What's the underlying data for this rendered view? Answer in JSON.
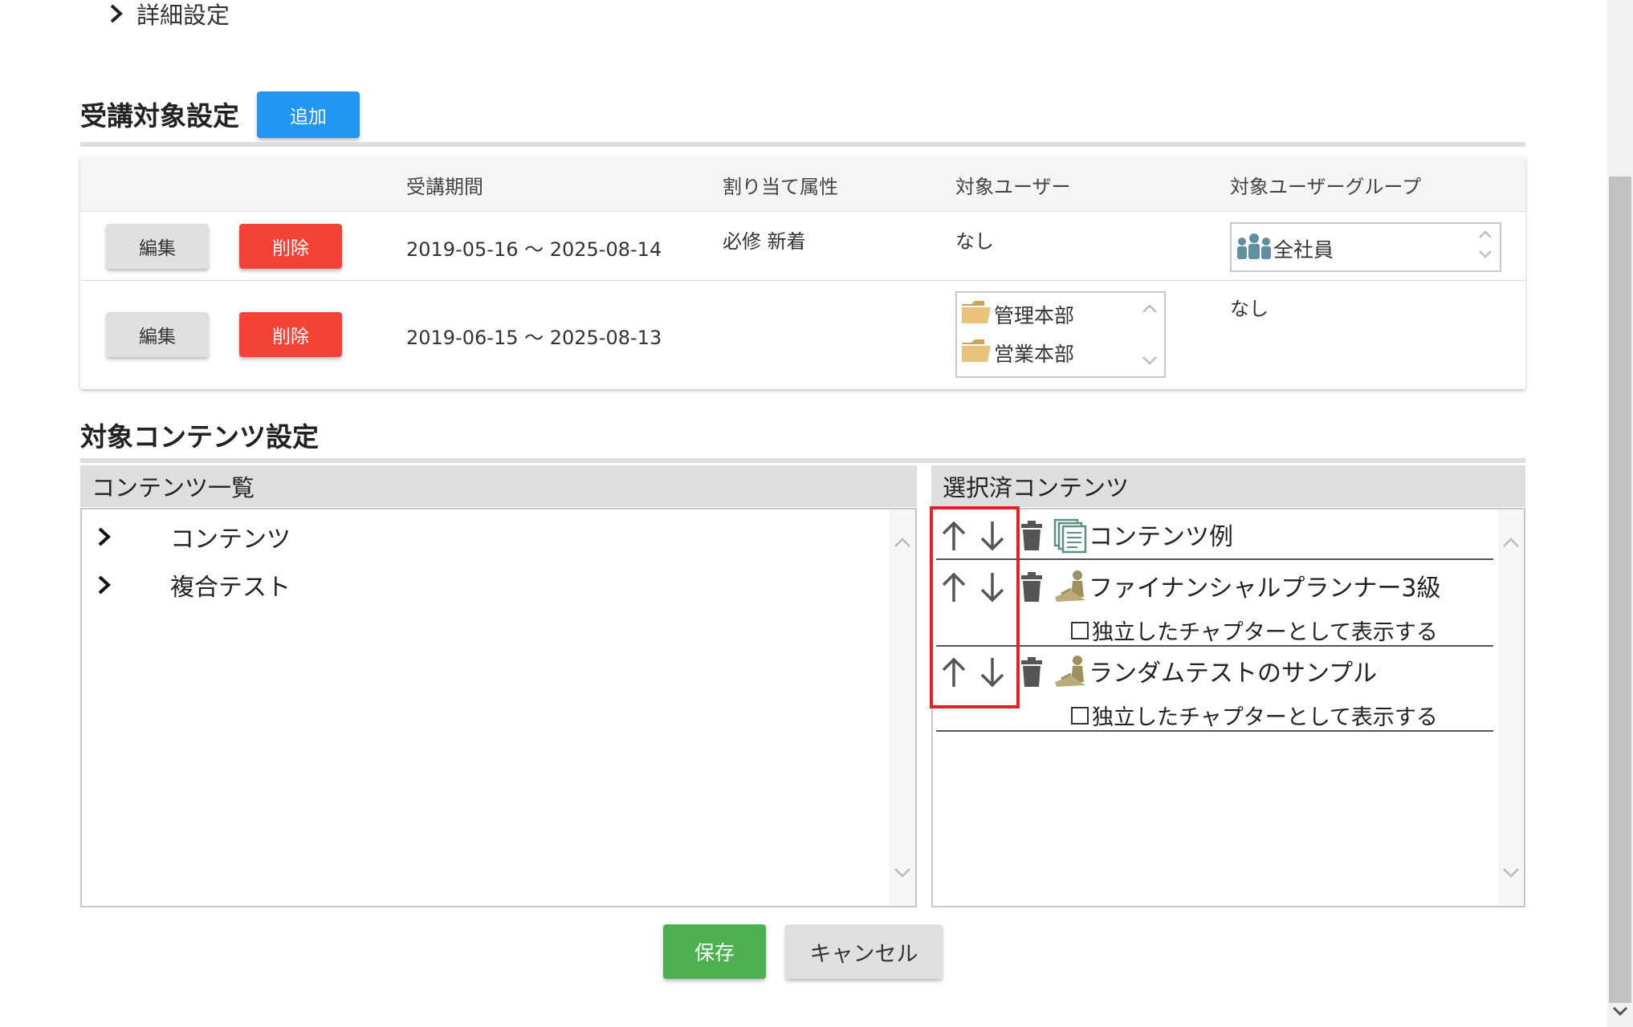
{
  "advanced": {
    "label": "詳細設定"
  },
  "target_section": {
    "title": "受講対象設定",
    "add_label": "追加",
    "headers": [
      "",
      "",
      "受講期間",
      "割り当て属性",
      "対象ユーザー",
      "対象ユーザーグループ"
    ],
    "rows": [
      {
        "edit_label": "編集",
        "delete_label": "削除",
        "period": "2019-05-16 〜 2025-08-14",
        "attributes": "必修 新着",
        "users": "なし",
        "groups": [
          "全社員"
        ]
      },
      {
        "edit_label": "編集",
        "delete_label": "削除",
        "period": "2019-06-15 〜 2025-08-13",
        "attributes": "",
        "users": [
          "管理本部",
          "営業本部"
        ],
        "groups": "なし"
      }
    ]
  },
  "content_section": {
    "title": "対象コンテンツ設定",
    "list_header": "コンテンツ一覧",
    "tree": [
      {
        "label": "コンテンツ"
      },
      {
        "label": "複合テスト"
      }
    ],
    "selected_header": "選択済コンテンツ",
    "selected": [
      {
        "title": "コンテンツ例",
        "icon": "content-stack-icon"
      },
      {
        "title": "ファイナンシャルプランナー3級",
        "icon": "test-person-icon",
        "option": "独立したチャプターとして表示する",
        "checked": false
      },
      {
        "title": "ランダムテストのサンプル",
        "icon": "test-person-icon",
        "option": "独立したチャプターとして表示する",
        "checked": false
      }
    ]
  },
  "footer": {
    "save_label": "保存",
    "cancel_label": "キャンセル"
  },
  "colors": {
    "add": "#2196f3",
    "delete": "#f44336",
    "save": "#4caf50",
    "neutral": "#e0e0e0",
    "highlight": "#e4202a"
  }
}
